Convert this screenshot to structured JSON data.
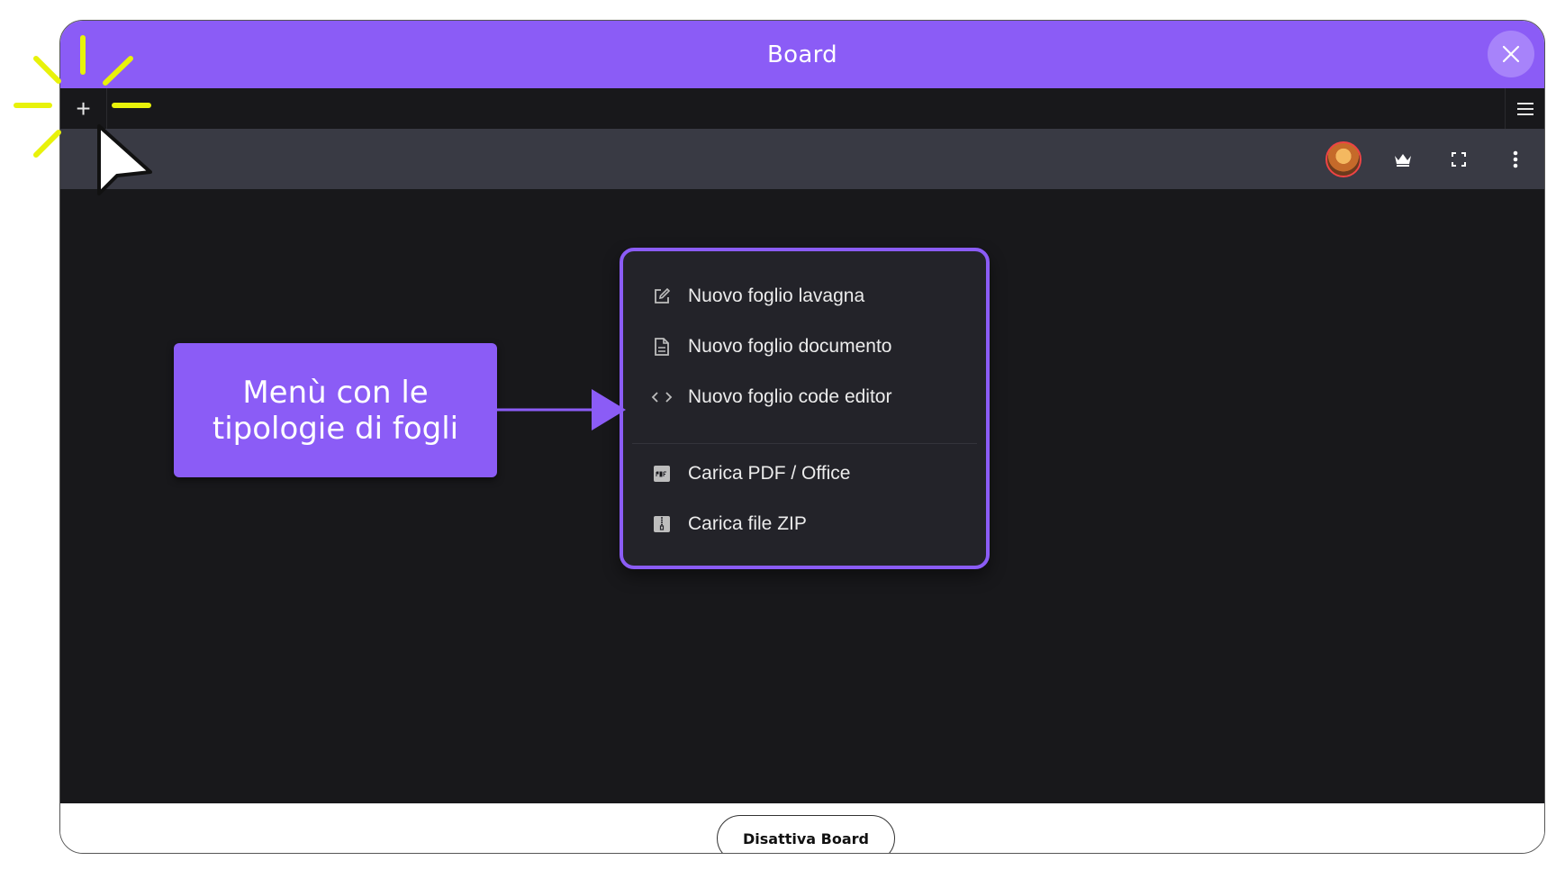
{
  "window": {
    "title": "Board",
    "close_icon": "close-icon"
  },
  "tabbar": {
    "add_symbol": "+",
    "menu_icon": "hamburger-icon"
  },
  "toolbar": {
    "icons": [
      "avatar",
      "crown-icon",
      "fullscreen-icon",
      "more-vertical-icon"
    ]
  },
  "menu": {
    "items": [
      {
        "label": "Nuovo foglio lavagna",
        "icon": "edit-icon"
      },
      {
        "label": "Nuovo foglio documento",
        "icon": "document-icon"
      },
      {
        "label": "Nuovo foglio code editor",
        "icon": "code-icon"
      },
      {
        "label": "Carica PDF / Office",
        "icon": "pdf-icon"
      },
      {
        "label": "Carica file ZIP",
        "icon": "zip-icon"
      }
    ]
  },
  "callout": {
    "line1": "Menù con le",
    "line2": "tipologie di fogli"
  },
  "footer": {
    "button_label": "Disattiva Board"
  },
  "colors": {
    "accent": "#8b5cf6",
    "highlight": "#e8f20a",
    "dark_bg": "#18181b",
    "toolbar_bg": "#393a44"
  }
}
